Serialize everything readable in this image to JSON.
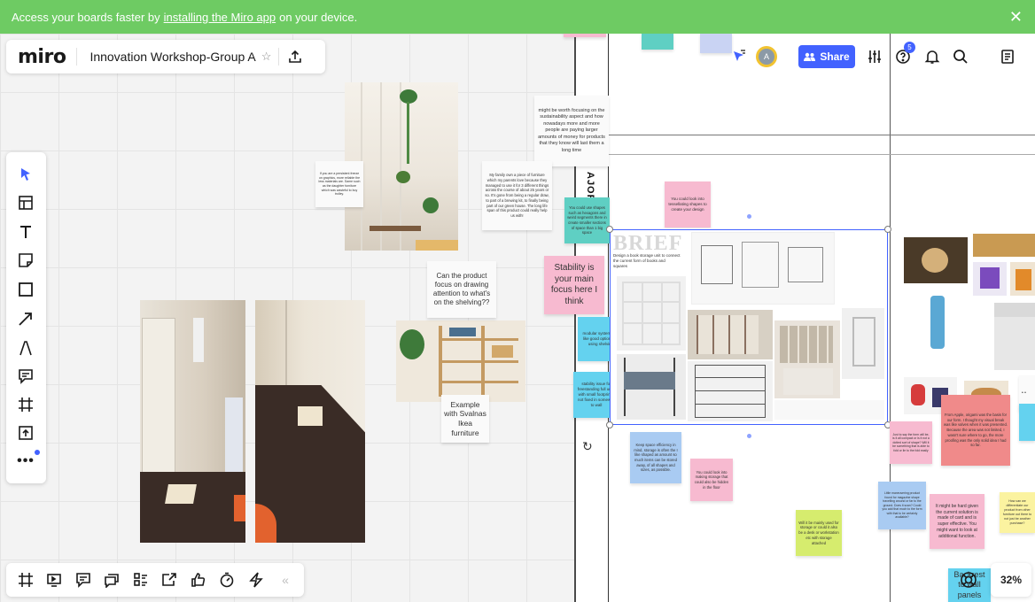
{
  "banner": {
    "text_before": "Access your boards faster by",
    "link_text": "installing the Miro app",
    "text_after": "on your device.",
    "close_glyph": "✕"
  },
  "header": {
    "logo": "miro",
    "board_title": "Innovation Workshop-Group A",
    "star_glyph": "☆"
  },
  "top_right": {
    "share_label": "Share",
    "avatar_initial": "A",
    "help_badge": "5"
  },
  "zoom": {
    "level": "32%"
  },
  "bottom_toolbar": {
    "collapse_glyph": "«"
  },
  "board": {
    "frame_label": "AJOR",
    "brief_title": "BRIEF",
    "brief_text": "Design a book storage unit to connect the current form of books and squares",
    "notes": {
      "note_mirror": "If you are a persistent freeze on graphics, more reliable the less materials are. Same such as the daughter furniture which was wasteful to buy trolley.",
      "note_sustainability": "might be worth focusing on the sustainability aspect and how nowadays more and more people are paying larger amounts of money for products that they know will last them a long time",
      "note_family": "My family own a piece of furniture which my parents love because they managed to use it for 3 different things across the course of about 25 years or so. It's gone from being a regular draw, to part of a brewing kit, to finally being part of our green house. The long life span of this product could really help us with!",
      "note_teal": "You could use shapes such as hexagons and weird segments there in create smaller sections of space than 1 big space",
      "note_product_focus": "Can the product focus on drawing attention to what's on the shelving??",
      "note_stability": "Stability is your main focus here I think",
      "note_modular": "modular system with like good options for using shelving",
      "note_freestanding": "stability issue for freestanding full units with small footprint if not fixed in someway to wall",
      "note_example": "Example with Svalnas Ikea furniture",
      "note_tessellating": "You could look into tessellating shapes to create your design",
      "note_space_efficiency": "Keep space efficiency in mind, storage is often the I like shaped as amount so much items can be stored away, of all shapes and sizes, as possible.",
      "note_hide_storage": "You could look into making storage that could also be hidden in the floor",
      "note_hidden_text": "Will it be mainly used for storage or could it also be a desk or workstation etc with storage attached",
      "note_seen_apple": "From Apple, origami was the basis for our form. I thought my visual break was like valves when it was presented. Because the area was not limited, I wasn't sure where to go, the more proofing was the only solid idea I had so far.",
      "note_pink_small": "Just to say the form will be, is it all compact or is it not a dotted sort of shape? Will it be something that is able to fold or lie to the fold easily",
      "note_blue_small": "Little maneuvering product found for magazine shape travelling around or far to the ground. Does it scan? Could you add that much to the form with that to be certainly available?",
      "note_red_small": "It might be hard given the current solution is made of card and is super effective. You might want to look at additional function.",
      "note_yellow_small": "How can we differentiate our product from other furniture out there to not just be another purchase?",
      "note_bottom_right": "Backrest to wall panels"
    }
  },
  "colors": {
    "banner_green": "#6ecb63",
    "accent_blue": "#4262ff",
    "avatar_yellow": "#f2c330"
  },
  "icons": {
    "left_toolbar": [
      "select-cursor-icon",
      "templates-icon",
      "text-icon",
      "sticky-note-icon",
      "shape-icon",
      "connection-line-icon",
      "pen-icon",
      "comment-icon",
      "frame-icon",
      "upload-icon",
      "more-tools-icon"
    ],
    "bottom_toolbar": [
      "frames-panel-icon",
      "presentation-icon",
      "comments-icon",
      "chat-icon",
      "cards-icon",
      "screen-share-icon",
      "voting-icon",
      "timer-icon",
      "activity-icon",
      "collapse-icon"
    ],
    "top_right": [
      "cursor-follow-icon",
      "settings-sliders-icon",
      "help-icon",
      "notifications-bell-icon",
      "search-icon",
      "notes-panel-icon"
    ]
  }
}
